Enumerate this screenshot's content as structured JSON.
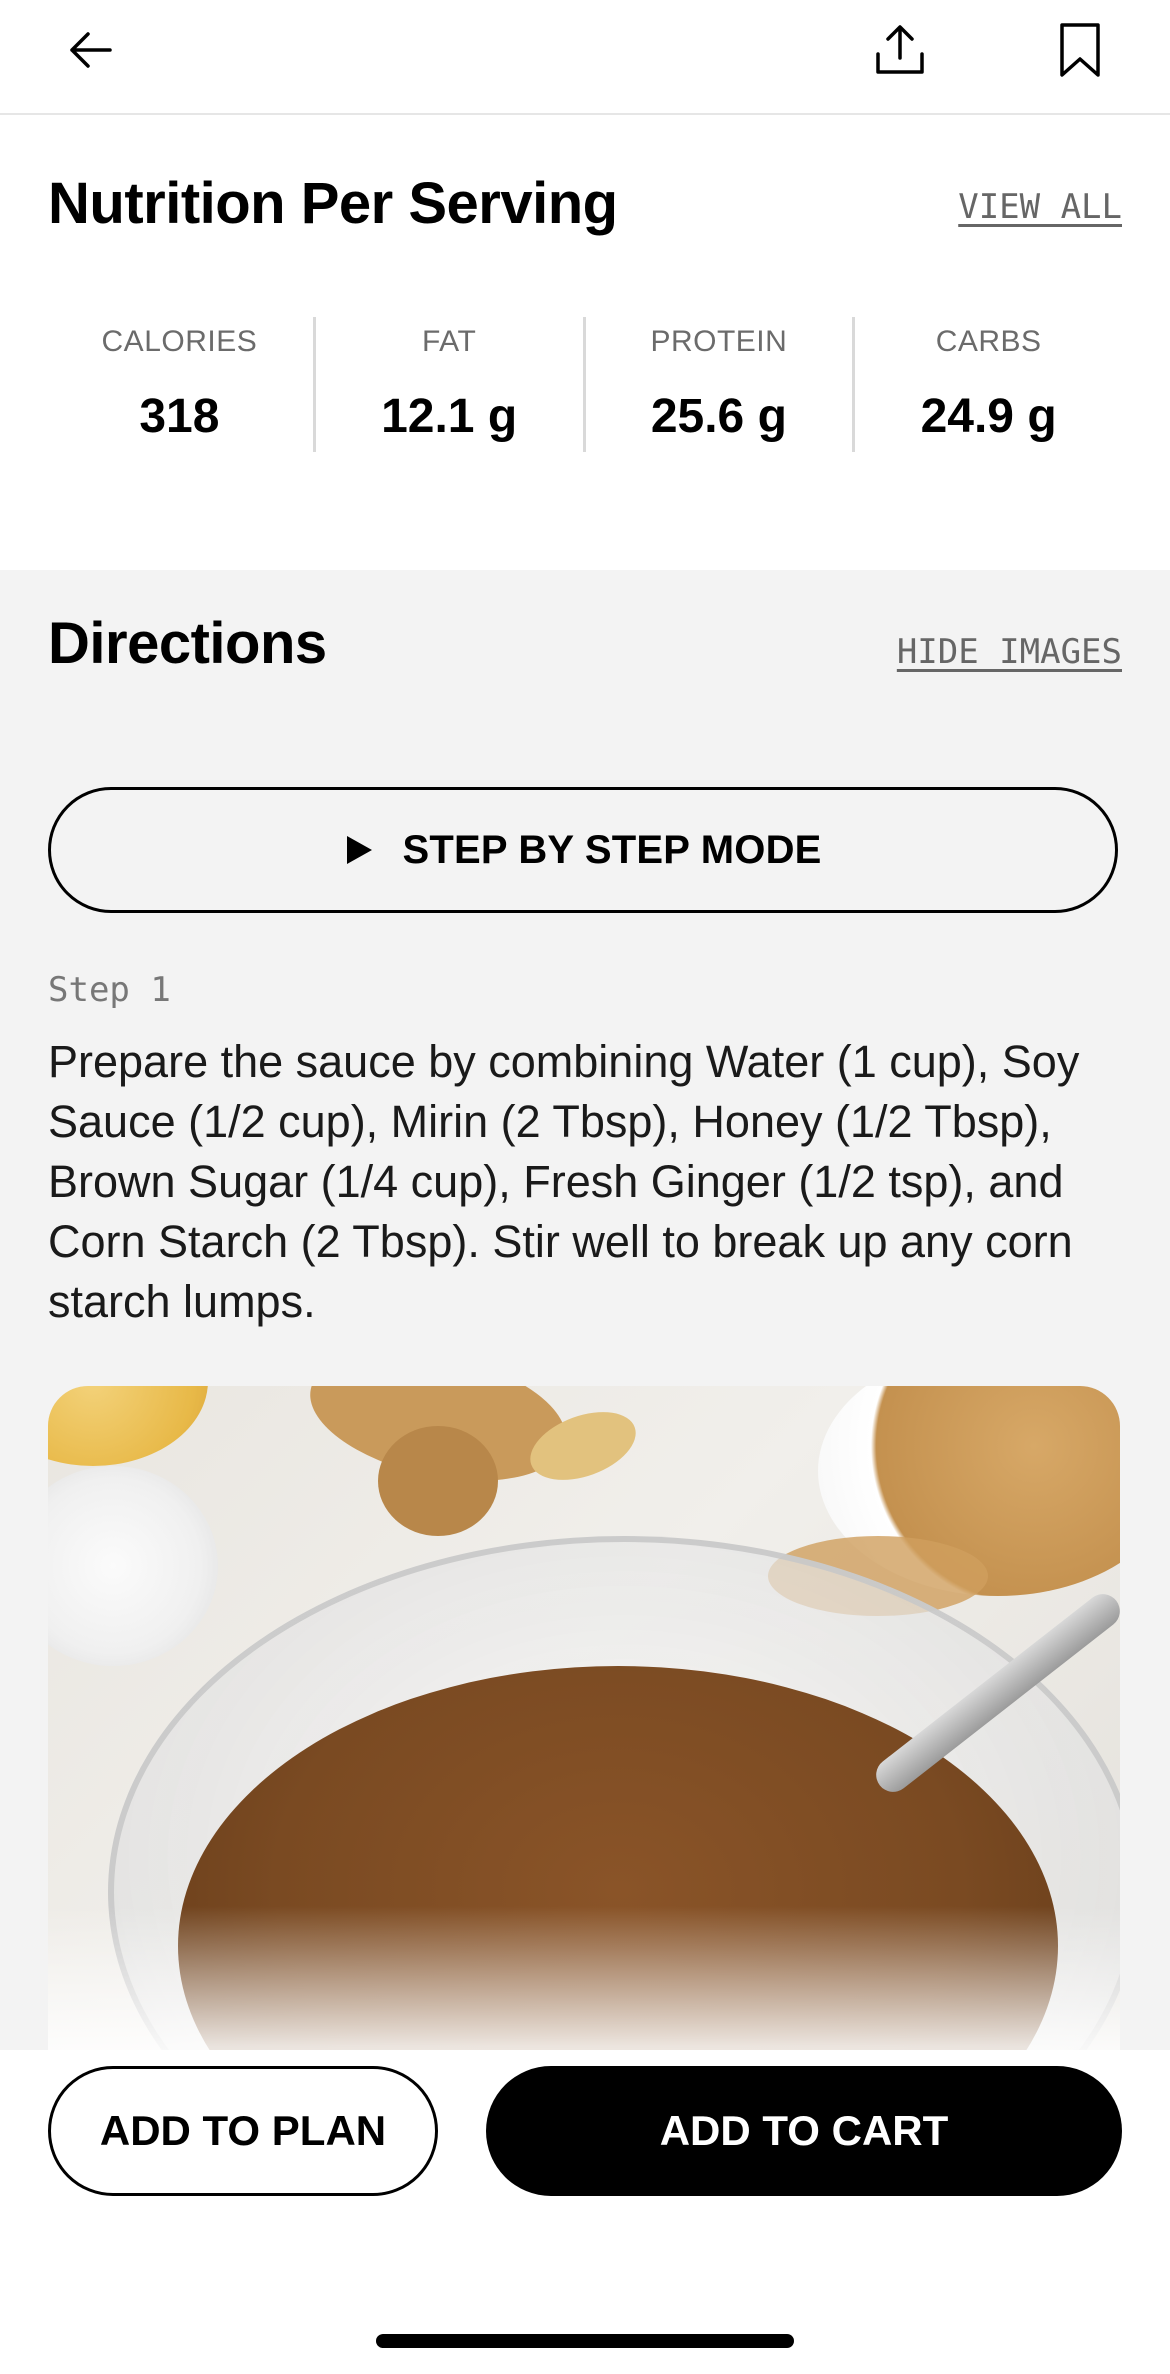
{
  "header": {
    "back_icon": "arrow-left-icon",
    "share_icon": "share-upload-icon",
    "bookmark_icon": "bookmark-icon"
  },
  "nutrition": {
    "title": "Nutrition Per Serving",
    "view_all": "VIEW ALL",
    "items": [
      {
        "label": "CALORIES",
        "value": "318"
      },
      {
        "label": "FAT",
        "value": "12.1 g"
      },
      {
        "label": "PROTEIN",
        "value": "25.6 g"
      },
      {
        "label": "CARBS",
        "value": "24.9 g"
      }
    ]
  },
  "directions": {
    "title": "Directions",
    "hide_images": "HIDE IMAGES",
    "step_mode_label": "STEP BY STEP MODE",
    "step_mode_icon": "play-icon",
    "steps": [
      {
        "label": "Step 1",
        "text": "Prepare the sauce by combining Water (1 cup), Soy Sauce (1/2 cup), Mirin (2 Tbsp), Honey (1/2 Tbsp), Brown Sugar (1/4 cup), Fresh Ginger (1/2 tsp), and Corn Starch (2 Tbsp). Stir well to break up any corn starch lumps."
      }
    ]
  },
  "actions": {
    "add_to_plan": "ADD TO PLAN",
    "add_to_cart": "ADD TO CART"
  },
  "colors": {
    "primary": "#000000",
    "section_bg": "#f3f3f3",
    "muted_text": "#6b6b6b",
    "sauce": "#7a4a22"
  }
}
